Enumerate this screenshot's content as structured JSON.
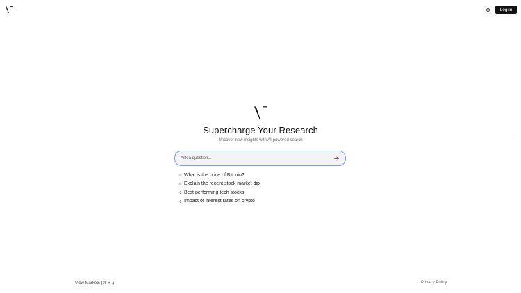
{
  "header": {
    "logo_icon": "v-logo-icon",
    "theme_icon": "sun-icon",
    "login_label": "Log in"
  },
  "hero": {
    "logo_icon": "v-logo-icon",
    "title": "Supercharge Your Research",
    "subtitle": "Uncover new insights with AI-powered search"
  },
  "search": {
    "placeholder": "Ask a question...",
    "value": "",
    "submit_icon": "arrow-right-icon"
  },
  "suggestions": [
    {
      "label": "What is the price of Bitcoin?",
      "icon": "arrow-right-icon"
    },
    {
      "label": "Explain the recent stock market dip",
      "icon": "arrow-right-icon"
    },
    {
      "label": "Best performing tech stocks",
      "icon": "arrow-right-icon"
    },
    {
      "label": "Impact of interest rates on crypto",
      "icon": "arrow-right-icon"
    }
  ],
  "footer": {
    "markets_link": "View Markets (⌘ + .)",
    "privacy_link": "Privacy Policy"
  },
  "colors": {
    "accent_border": "#7aa0f0",
    "button_bg": "#111111",
    "input_bg": "#f3f3f5"
  }
}
